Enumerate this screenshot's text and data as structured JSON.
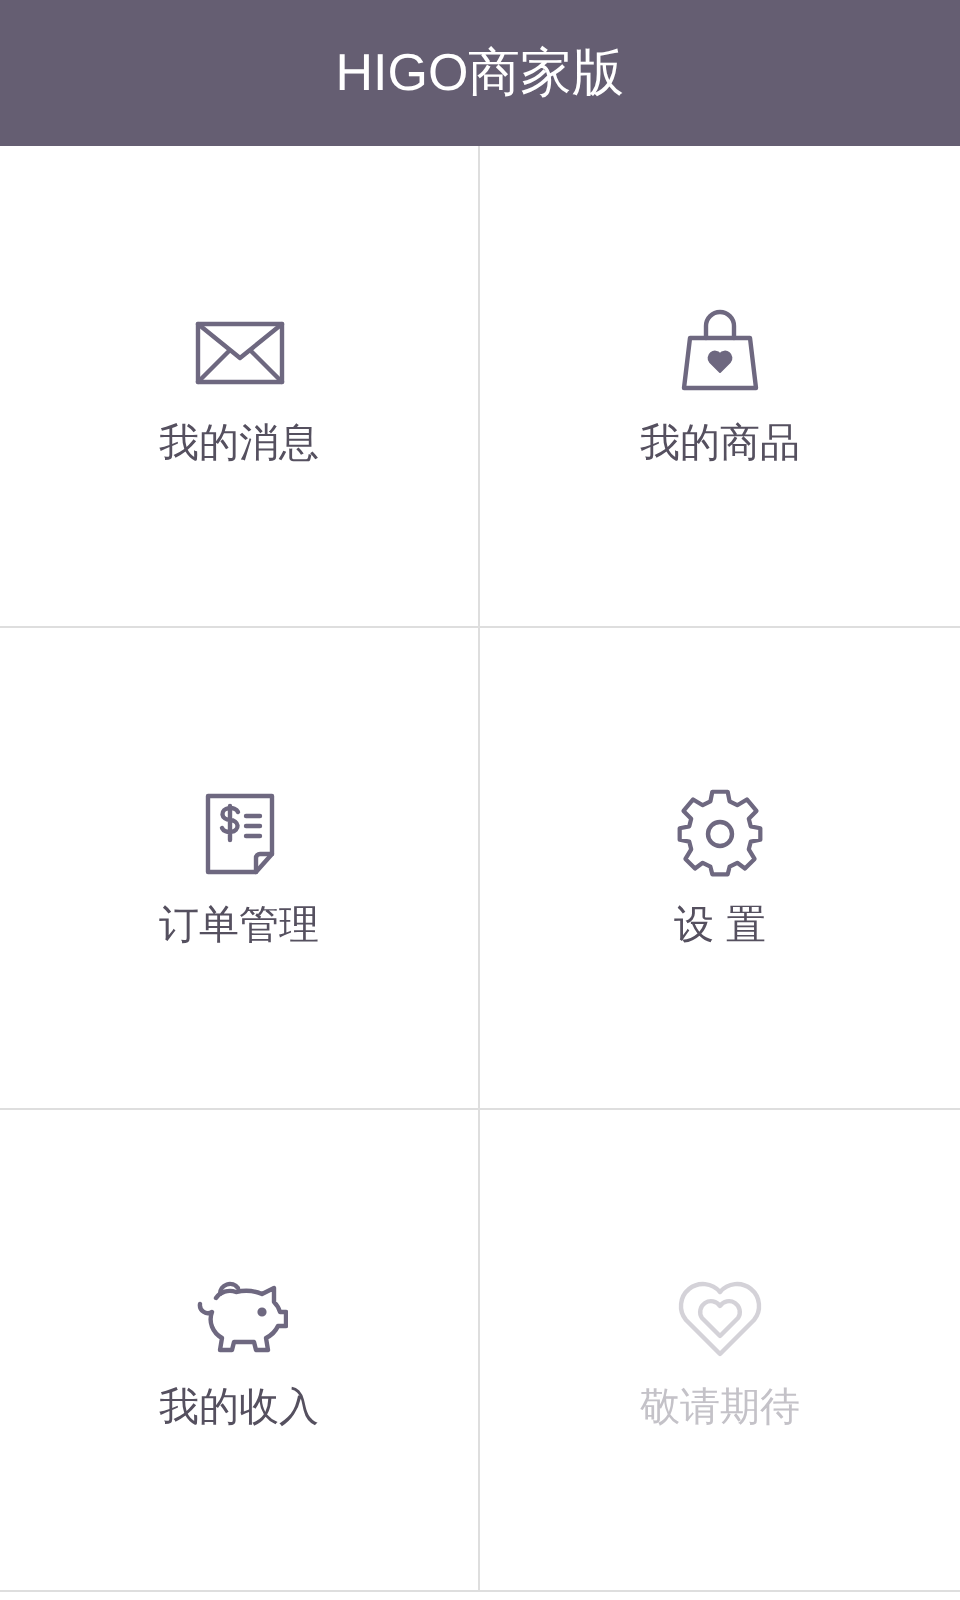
{
  "header": {
    "title": "HIGO商家版"
  },
  "tiles": [
    {
      "kind": "envelope",
      "label": "我的消息",
      "disabled": false
    },
    {
      "kind": "bag",
      "label": "我的商品",
      "disabled": false
    },
    {
      "kind": "invoice",
      "label": "订单管理",
      "disabled": false
    },
    {
      "kind": "gear",
      "label": "设 置",
      "disabled": false
    },
    {
      "kind": "piggy",
      "label": "我的收入",
      "disabled": false
    },
    {
      "kind": "heart",
      "label": "敬请期待",
      "disabled": true
    }
  ]
}
